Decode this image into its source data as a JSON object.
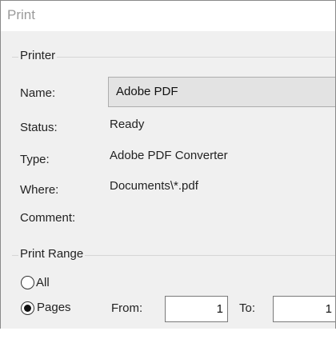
{
  "window": {
    "title": "Print"
  },
  "printer": {
    "group_label": "Printer",
    "name_label": "Name:",
    "name_value": "Adobe PDF",
    "status_label": "Status:",
    "status_value": "Ready",
    "type_label": "Type:",
    "type_value": "Adobe PDF Converter",
    "where_label": "Where:",
    "where_value": "Documents\\*.pdf",
    "comment_label": "Comment:"
  },
  "print_range": {
    "group_label": "Print Range",
    "all_label": "All",
    "all_selected": false,
    "pages_label": "Pages",
    "pages_selected": true,
    "from_label": "From:",
    "from_value": "1",
    "to_label": "To:",
    "to_value": "1"
  }
}
